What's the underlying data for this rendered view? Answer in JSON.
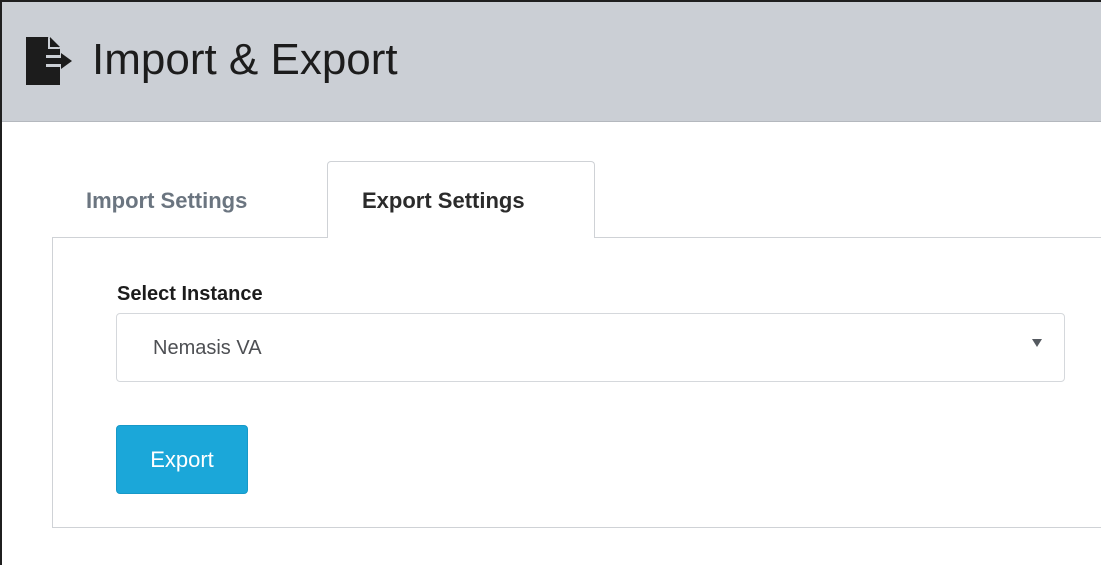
{
  "header": {
    "title": "Import & Export",
    "icon": "file-export-icon",
    "background_color": "#cbcfd5"
  },
  "tabs": [
    {
      "label": "Import Settings",
      "active": false
    },
    {
      "label": "Export Settings",
      "active": true
    }
  ],
  "form": {
    "instance_label": "Select Instance",
    "instance_value": "Nemasis VA",
    "dropdown_icon": "caret-down-icon",
    "export_button_label": "Export",
    "export_button_color": "#1ba7d9"
  }
}
